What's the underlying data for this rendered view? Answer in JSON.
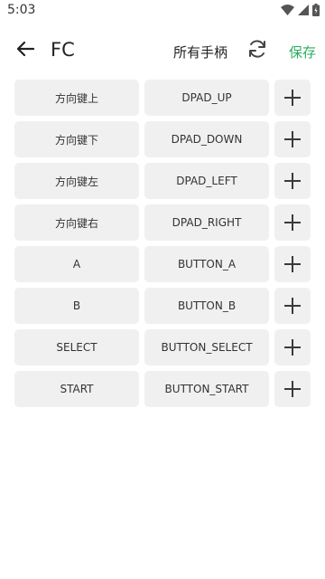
{
  "status_bar": {
    "time": "5:03"
  },
  "app_bar": {
    "title": "FC",
    "filter_label": "所有手柄",
    "save_label": "保存",
    "accent_color": "#27ae60"
  },
  "mappings": [
    {
      "name": "方向键上",
      "code": "DPAD_UP"
    },
    {
      "name": "方向键下",
      "code": "DPAD_DOWN"
    },
    {
      "name": "方向键左",
      "code": "DPAD_LEFT"
    },
    {
      "name": "方向键右",
      "code": "DPAD_RIGHT"
    },
    {
      "name": "A",
      "code": "BUTTON_A"
    },
    {
      "name": "B",
      "code": "BUTTON_B"
    },
    {
      "name": "SELECT",
      "code": "BUTTON_SELECT"
    },
    {
      "name": "START",
      "code": "BUTTON_START"
    }
  ],
  "icons": {
    "back": "arrow-left-icon",
    "refresh": "refresh-icon",
    "add": "plus-icon",
    "wifi": "wifi-icon",
    "signal": "signal-icon",
    "battery": "battery-icon"
  }
}
